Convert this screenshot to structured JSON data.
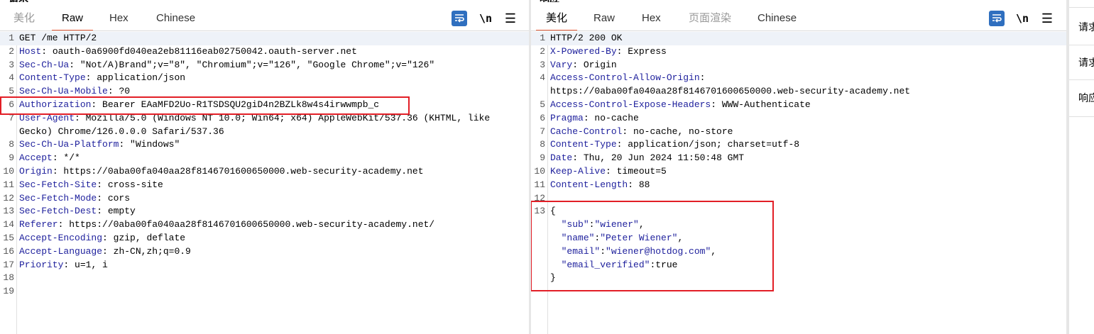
{
  "request": {
    "heading": "请求",
    "tabs": [
      {
        "label": "美化",
        "state": "muted"
      },
      {
        "label": "Raw",
        "state": "active"
      },
      {
        "label": "Hex",
        "state": "normal"
      },
      {
        "label": "Chinese",
        "state": "normal"
      }
    ],
    "tools": {
      "newline_label": "\\n",
      "menu_label": "☰"
    },
    "lines": [
      {
        "n": "1",
        "key": "",
        "val": "GET /me HTTP/2"
      },
      {
        "n": "2",
        "key": "Host",
        "val": " oauth-0a6900fd040ea2eb81116eab02750042.oauth-server.net"
      },
      {
        "n": "3",
        "key": "Sec-Ch-Ua",
        "val": " \"Not/A)Brand\";v=\"8\", \"Chromium\";v=\"126\", \"Google Chrome\";v=\"126\""
      },
      {
        "n": "4",
        "key": "Content-Type",
        "val": " application/json"
      },
      {
        "n": "5",
        "key": "Sec-Ch-Ua-Mobile",
        "val": " ?0"
      },
      {
        "n": "6",
        "key": "Authorization",
        "val": " Bearer EAaMFD2Uo-R1TSDSQU2giD4n2BZLk8w4s4irwwmpb_c"
      },
      {
        "n": "7",
        "key": "User-Agent",
        "val": " Mozilla/5.0 (Windows NT 10.0; Win64; x64) AppleWebKit/537.36 (KHTML, like"
      },
      {
        "n": "",
        "key": "",
        "val": "Gecko) Chrome/126.0.0.0 Safari/537.36"
      },
      {
        "n": "8",
        "key": "Sec-Ch-Ua-Platform",
        "val": " \"Windows\""
      },
      {
        "n": "9",
        "key": "Accept",
        "val": " */*"
      },
      {
        "n": "10",
        "key": "Origin",
        "val": " https://0aba00fa040aa28f8146701600650000.web-security-academy.net"
      },
      {
        "n": "11",
        "key": "Sec-Fetch-Site",
        "val": " cross-site"
      },
      {
        "n": "12",
        "key": "Sec-Fetch-Mode",
        "val": " cors"
      },
      {
        "n": "13",
        "key": "Sec-Fetch-Dest",
        "val": " empty"
      },
      {
        "n": "14",
        "key": "Referer",
        "val": " https://0aba00fa040aa28f8146701600650000.web-security-academy.net/"
      },
      {
        "n": "15",
        "key": "Accept-Encoding",
        "val": " gzip, deflate"
      },
      {
        "n": "16",
        "key": "Accept-Language",
        "val": " zh-CN,zh;q=0.9"
      },
      {
        "n": "17",
        "key": "Priority",
        "val": " u=1, i"
      },
      {
        "n": "18",
        "key": "",
        "val": ""
      },
      {
        "n": "19",
        "key": "",
        "val": ""
      }
    ]
  },
  "response": {
    "heading": "响应",
    "tabs": [
      {
        "label": "美化",
        "state": "active"
      },
      {
        "label": "Raw",
        "state": "normal"
      },
      {
        "label": "Hex",
        "state": "normal"
      },
      {
        "label": "页面渲染",
        "state": "muted"
      },
      {
        "label": "Chinese",
        "state": "normal"
      }
    ],
    "tools": {
      "newline_label": "\\n",
      "menu_label": "☰"
    },
    "lines": [
      {
        "n": "1",
        "key": "",
        "val": "HTTP/2 200 OK"
      },
      {
        "n": "2",
        "key": "X-Powered-By",
        "val": " Express"
      },
      {
        "n": "3",
        "key": "Vary",
        "val": " Origin"
      },
      {
        "n": "4",
        "key": "Access-Control-Allow-Origin",
        "val": ""
      },
      {
        "n": "",
        "key": "",
        "val": "https://0aba00fa040aa28f8146701600650000.web-security-academy.net"
      },
      {
        "n": "5",
        "key": "Access-Control-Expose-Headers",
        "val": " WWW-Authenticate"
      },
      {
        "n": "6",
        "key": "Pragma",
        "val": " no-cache"
      },
      {
        "n": "7",
        "key": "Cache-Control",
        "val": " no-cache, no-store"
      },
      {
        "n": "8",
        "key": "Content-Type",
        "val": " application/json; charset=utf-8"
      },
      {
        "n": "9",
        "key": "Date",
        "val": " Thu, 20 Jun 2024 11:50:48 GMT"
      },
      {
        "n": "10",
        "key": "Keep-Alive",
        "val": " timeout=5"
      },
      {
        "n": "11",
        "key": "Content-Length",
        "val": " 88"
      },
      {
        "n": "12",
        "key": "",
        "val": ""
      },
      {
        "n": "13",
        "key": "",
        "val": "{"
      },
      {
        "n": "",
        "key": "",
        "val": "",
        "json": {
          "k": "\"sub\"",
          "v": "\"wiener\"",
          "tail": ","
        }
      },
      {
        "n": "",
        "key": "",
        "val": "",
        "json": {
          "k": "\"name\"",
          "v": "\"Peter Wiener\"",
          "tail": ","
        }
      },
      {
        "n": "",
        "key": "",
        "val": "",
        "json": {
          "k": "\"email\"",
          "v": "\"wiener@hotdog.com\"",
          "tail": ","
        }
      },
      {
        "n": "",
        "key": "",
        "val": "",
        "json": {
          "k": "\"email_verified\"",
          "v": "true",
          "tail": "",
          "plain": true
        }
      },
      {
        "n": "",
        "key": "",
        "val": "}"
      }
    ]
  },
  "side_panel": {
    "items": [
      {
        "label": "请求"
      },
      {
        "label": "请求"
      },
      {
        "label": "响应"
      }
    ]
  },
  "colors": {
    "highlight_box": "#e21e26",
    "active_tab_underline": "#e8603c",
    "header_key": "#1d1f9c",
    "wrap_button": "#2f6fbf"
  }
}
